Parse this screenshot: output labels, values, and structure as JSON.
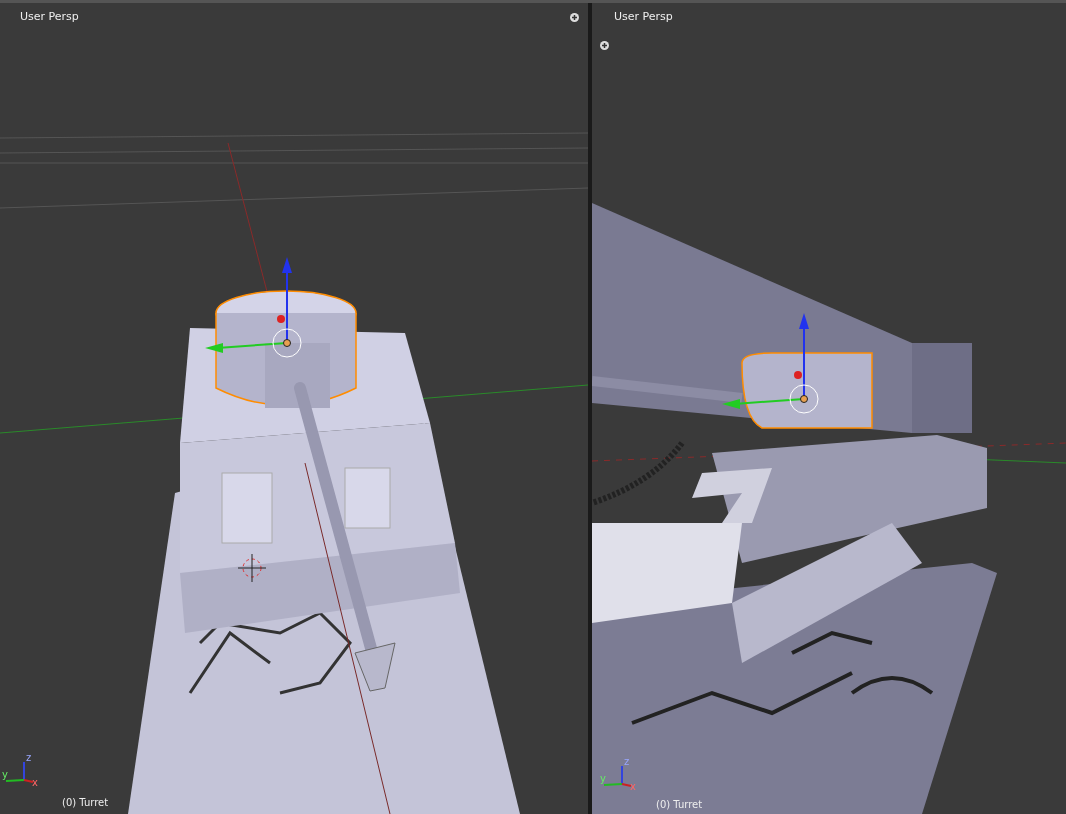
{
  "viewports": [
    {
      "kind": "top",
      "view_label": "User Persp",
      "object_label": "(0) Turret",
      "axes": {
        "x": "x",
        "y": "y",
        "z": "z"
      }
    },
    {
      "kind": "side",
      "view_label": "User Persp",
      "object_label": "(0) Turret",
      "axes": {
        "x": "x",
        "y": "y",
        "z": "z"
      }
    }
  ]
}
